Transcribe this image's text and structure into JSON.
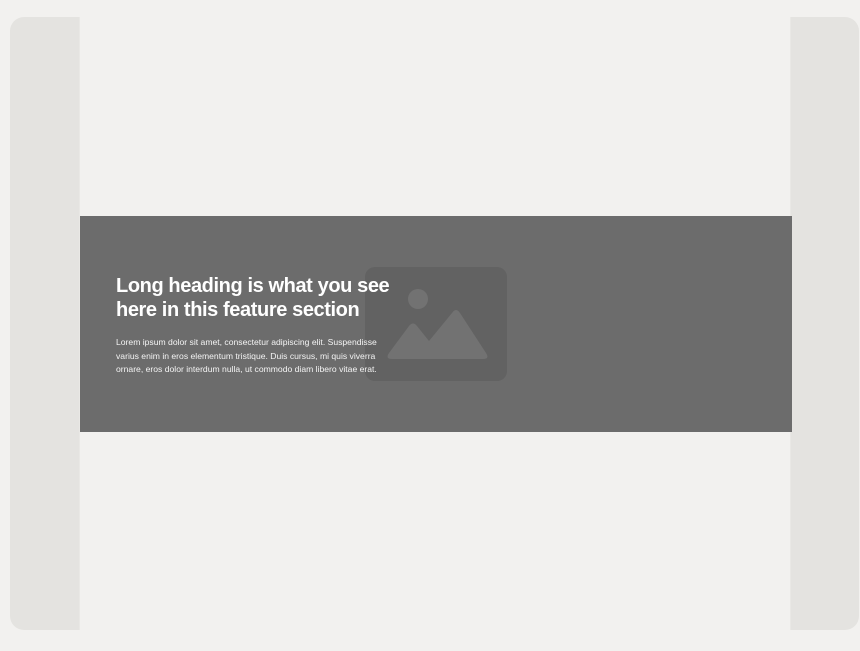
{
  "feature": {
    "heading": "Long heading is what you see here in this feature section",
    "body": "Lorem ipsum dolor sit amet, consectetur adipiscing elit. Suspendisse varius enim in eros elementum tristique. Duis cursus, mi quis viverra ornare, eros dolor interdum nulla, ut commodo diam libero vitae erat.",
    "image_icon": "image-placeholder-icon"
  },
  "colors": {
    "page_background": "#f2f1ef",
    "frame_side": "#e4e3e0",
    "feature_background": "#6c6c6c",
    "placeholder_box": "#626262",
    "placeholder_glyph": "#727272",
    "text": "#ffffff"
  }
}
